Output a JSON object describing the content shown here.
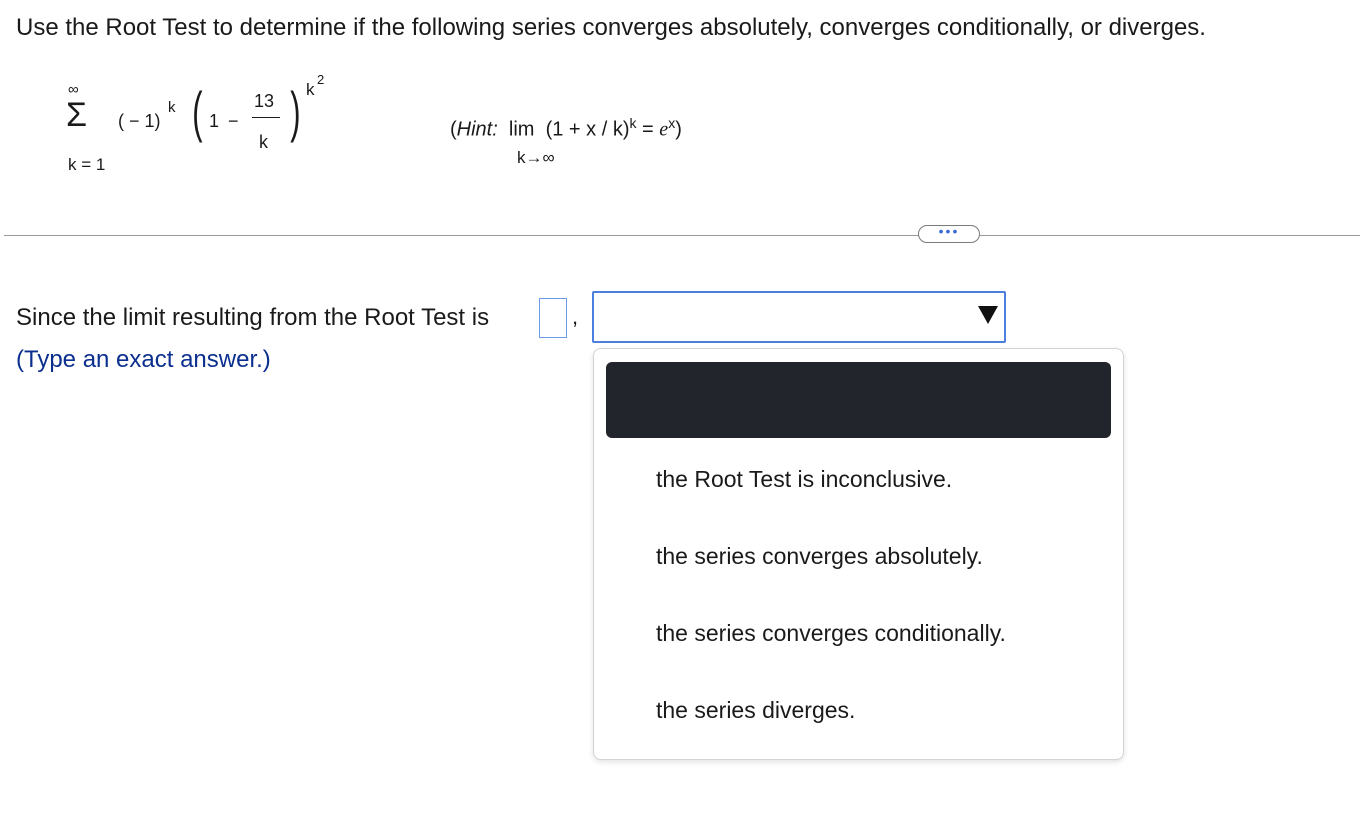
{
  "question": "Use the Root Test to determine if the following series converges absolutely, converges conditionally, or diverges.",
  "series": {
    "sum_symbol": "Σ",
    "upper_limit": "∞",
    "lower_limit": "k = 1",
    "sign_factor": "( − 1)",
    "sign_exponent": "k",
    "left_paren": "(",
    "right_paren": ")",
    "one": "1",
    "minus": "−",
    "numerator": "13",
    "denominator": "k",
    "outer_exponent_base": "k",
    "outer_exponent_power": "2"
  },
  "hint": {
    "label": "Hint:",
    "open": "(",
    "lim": "lim",
    "expr": "(1 + x / k)",
    "expr_exp": "k",
    "equals": " = ",
    "e": "e",
    "e_exp": "x",
    "close": ")",
    "sub": "k→∞"
  },
  "more_button_label": "•••",
  "answer": {
    "prompt": "Since the limit resulting from the Root Test is",
    "value": "",
    "comma": ",",
    "select_value": "",
    "instruction": "(Type an exact answer.)"
  },
  "dropdown": {
    "highlighted_option": "",
    "options": [
      "the Root Test is inconclusive.",
      "the series converges absolutely.",
      "the series converges conditionally.",
      "the series diverges."
    ]
  }
}
